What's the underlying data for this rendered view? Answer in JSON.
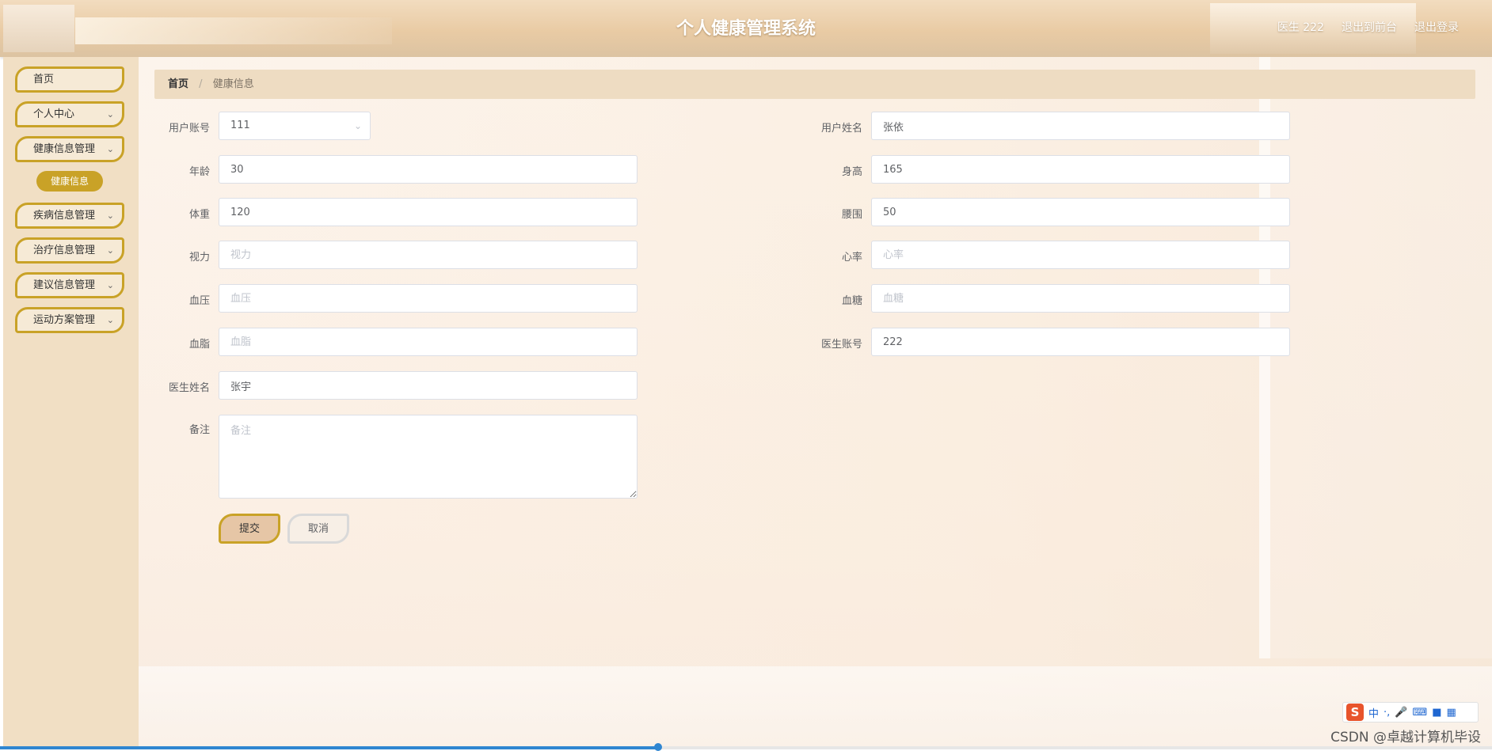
{
  "header": {
    "title": "个人健康管理系统",
    "user_label": "医生 222",
    "back_to_front": "退出到前台",
    "logout": "退出登录"
  },
  "sidebar": {
    "items": [
      {
        "label": "首页",
        "has_arrow": false
      },
      {
        "label": "个人中心",
        "has_arrow": true
      },
      {
        "label": "健康信息管理",
        "has_arrow": true,
        "expanded": true
      },
      {
        "label": "疾病信息管理",
        "has_arrow": true
      },
      {
        "label": "治疗信息管理",
        "has_arrow": true
      },
      {
        "label": "建议信息管理",
        "has_arrow": true
      },
      {
        "label": "运动方案管理",
        "has_arrow": true
      }
    ],
    "active_subitem": "健康信息"
  },
  "breadcrumb": {
    "home": "首页",
    "separator": "/",
    "current": "健康信息"
  },
  "form": {
    "user_account": {
      "label": "用户账号",
      "value": "111"
    },
    "user_name": {
      "label": "用户姓名",
      "value": "张依"
    },
    "age": {
      "label": "年龄",
      "value": "30"
    },
    "height": {
      "label": "身高",
      "value": "165"
    },
    "weight": {
      "label": "体重",
      "value": "120"
    },
    "waist": {
      "label": "腰围",
      "value": "50"
    },
    "vision": {
      "label": "视力",
      "placeholder": "视力"
    },
    "heart_rate": {
      "label": "心率",
      "placeholder": "心率"
    },
    "blood_pressure": {
      "label": "血压",
      "placeholder": "血压"
    },
    "blood_sugar": {
      "label": "血糖",
      "placeholder": "血糖"
    },
    "blood_lipid": {
      "label": "血脂",
      "placeholder": "血脂"
    },
    "doctor_account": {
      "label": "医生账号",
      "value": "222"
    },
    "doctor_name": {
      "label": "医生姓名",
      "value": "张宇"
    },
    "remark": {
      "label": "备注",
      "placeholder": "备注"
    }
  },
  "buttons": {
    "submit": "提交",
    "cancel": "取消"
  },
  "ime": {
    "logo": "S",
    "mode": "中",
    "icons": [
      "punctuation-icon",
      "microphone-icon",
      "keyboard-icon",
      "skin-icon",
      "grid-icon"
    ]
  },
  "watermark": "CSDN @卓越计算机毕设",
  "colors": {
    "accent_gold": "#c9a227",
    "header_bg": "#e9cba4",
    "sidebar_bg": "#f1dfc4",
    "breadcrumb_bg": "#eedcc2"
  }
}
